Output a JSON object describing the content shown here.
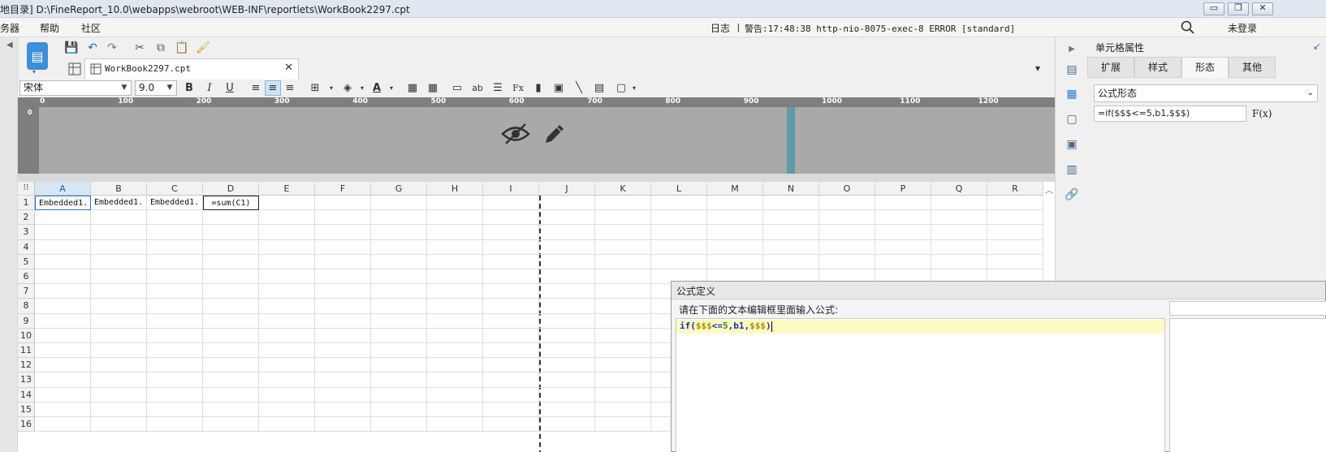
{
  "window": {
    "title": "地目录]   D:\\FineReport_10.0\\webapps\\webroot\\WEB-INF\\reportlets\\WorkBook2297.cpt",
    "minimize": "▭",
    "restore": "❐",
    "close": "✕"
  },
  "menu": {
    "items": [
      "务器",
      "帮助",
      "社区"
    ],
    "log_label": "日志",
    "log_message": "警告:17:48:38 http-nio-8075-exec-8 ERROR [standard]",
    "login": "未登录"
  },
  "tab": {
    "file_name": "WorkBook2297.cpt",
    "close": "✕"
  },
  "format": {
    "font_name": "宋体",
    "font_size": "9.0"
  },
  "ruler": {
    "ticks": [
      "0",
      "100",
      "200",
      "300",
      "400",
      "500",
      "600",
      "700",
      "800",
      "900",
      "1000",
      "1100",
      "1200"
    ]
  },
  "grid": {
    "columns": [
      "A",
      "B",
      "C",
      "D",
      "E",
      "F",
      "G",
      "H",
      "I",
      "J",
      "K",
      "L",
      "M",
      "N",
      "O",
      "P",
      "Q",
      "R"
    ],
    "rows": [
      "1",
      "2",
      "3",
      "4",
      "5",
      "6",
      "7",
      "8",
      "9",
      "10",
      "11",
      "12",
      "13",
      "14",
      "15",
      "16"
    ],
    "cells": {
      "A1": "Embedded1.",
      "B1": "Embedded1.",
      "C1": "Embedded1.",
      "D1": "=sum(C1)"
    }
  },
  "properties": {
    "title": "单元格属性",
    "tabs": [
      "扩展",
      "样式",
      "形态",
      "其他"
    ],
    "active_tab": "形态",
    "form_type": "公式形态",
    "formula": "=if($$$<=5,b1,$$$)",
    "fx": "F(x)"
  },
  "dialog": {
    "title": "公式定义",
    "prompt": "请在下面的文本编辑框里面输入公式:",
    "code_kw": "if(",
    "code_p1": "$$$",
    "code_op": "<=",
    "code_n": "5",
    "code_c1": ",b1,",
    "code_p2": "$$$",
    "code_end": ")"
  },
  "colors": {
    "accent": "#3c8fd8",
    "header_area": "#a9a9a9",
    "ruler": "#7e7e7e",
    "marker": "#5f9aa6",
    "editor_line": "#fcfbc4"
  }
}
